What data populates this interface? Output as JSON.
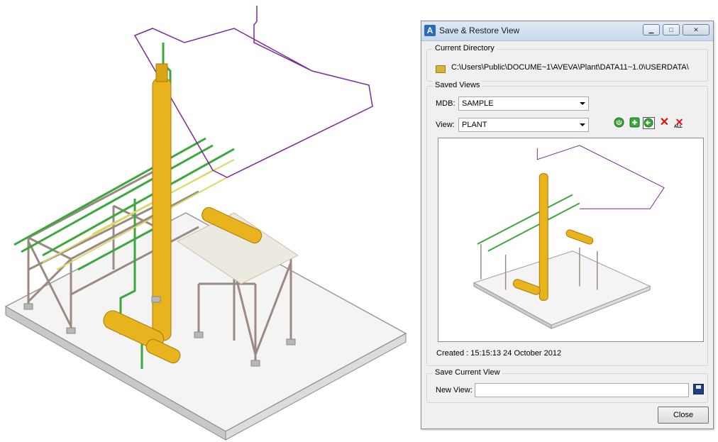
{
  "window": {
    "title": "Save & Restore View",
    "app_icon": "A"
  },
  "current_directory": {
    "label": "Current Directory",
    "path": "C:\\Users\\Public\\DOCUME~1\\AVEVA\\Plant\\DATA11~1.0\\USERDATA\\"
  },
  "saved_views": {
    "label": "Saved Views",
    "mdb_label": "MDB:",
    "mdb_value": "SAMPLE",
    "view_label": "View:",
    "view_value": "PLANT",
    "toolbar": [
      "restore-view-icon",
      "add-view-icon",
      "replace-view-icon",
      "delete-view-icon",
      "delete-all-icon"
    ],
    "delete_all_text": "ALL",
    "created": "Created : 15:15:13 24 October 2012"
  },
  "save_current_view": {
    "label": "Save Current View",
    "new_view_label": "New View:",
    "new_view_value": ""
  },
  "buttons": {
    "close": "Close"
  },
  "colors": {
    "steel": "#9c8a82",
    "vessel": "#e8b31c",
    "pipe_green": "#3aa83a",
    "pipe_purple": "#7a2a9a",
    "pipe_yellow": "#d8d86a"
  }
}
